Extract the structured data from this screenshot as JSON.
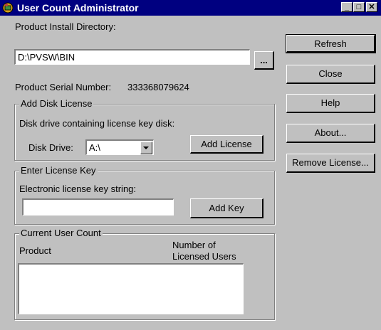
{
  "window": {
    "title": "User Count Administrator",
    "minimize_glyph": "_",
    "maximize_glyph": "□",
    "close_glyph": "✕",
    "title_bar_color": "#000080",
    "face_color": "#c0c0c0"
  },
  "install": {
    "label": "Product Install Directory:",
    "value": "D:\\PVSW\\BIN",
    "browse_label": "..."
  },
  "serial": {
    "label": "Product Serial Number:",
    "value": "333368079624"
  },
  "disk_license": {
    "group_title": "Add Disk License",
    "description": "Disk drive containing license key disk:",
    "drive_label": "Disk Drive:",
    "drive_value": "A:\\",
    "add_button": "Add License"
  },
  "license_key": {
    "group_title": "Enter License Key",
    "description": "Electronic license key string:",
    "value": "",
    "add_button": "Add Key"
  },
  "user_count": {
    "group_title": "Current User Count",
    "col_product": "Product",
    "col_users_line1": "Number of",
    "col_users_line2": "Licensed Users",
    "rows": []
  },
  "buttons": {
    "refresh": "Refresh",
    "close": "Close",
    "help": "Help",
    "about": "About...",
    "remove": "Remove License..."
  }
}
